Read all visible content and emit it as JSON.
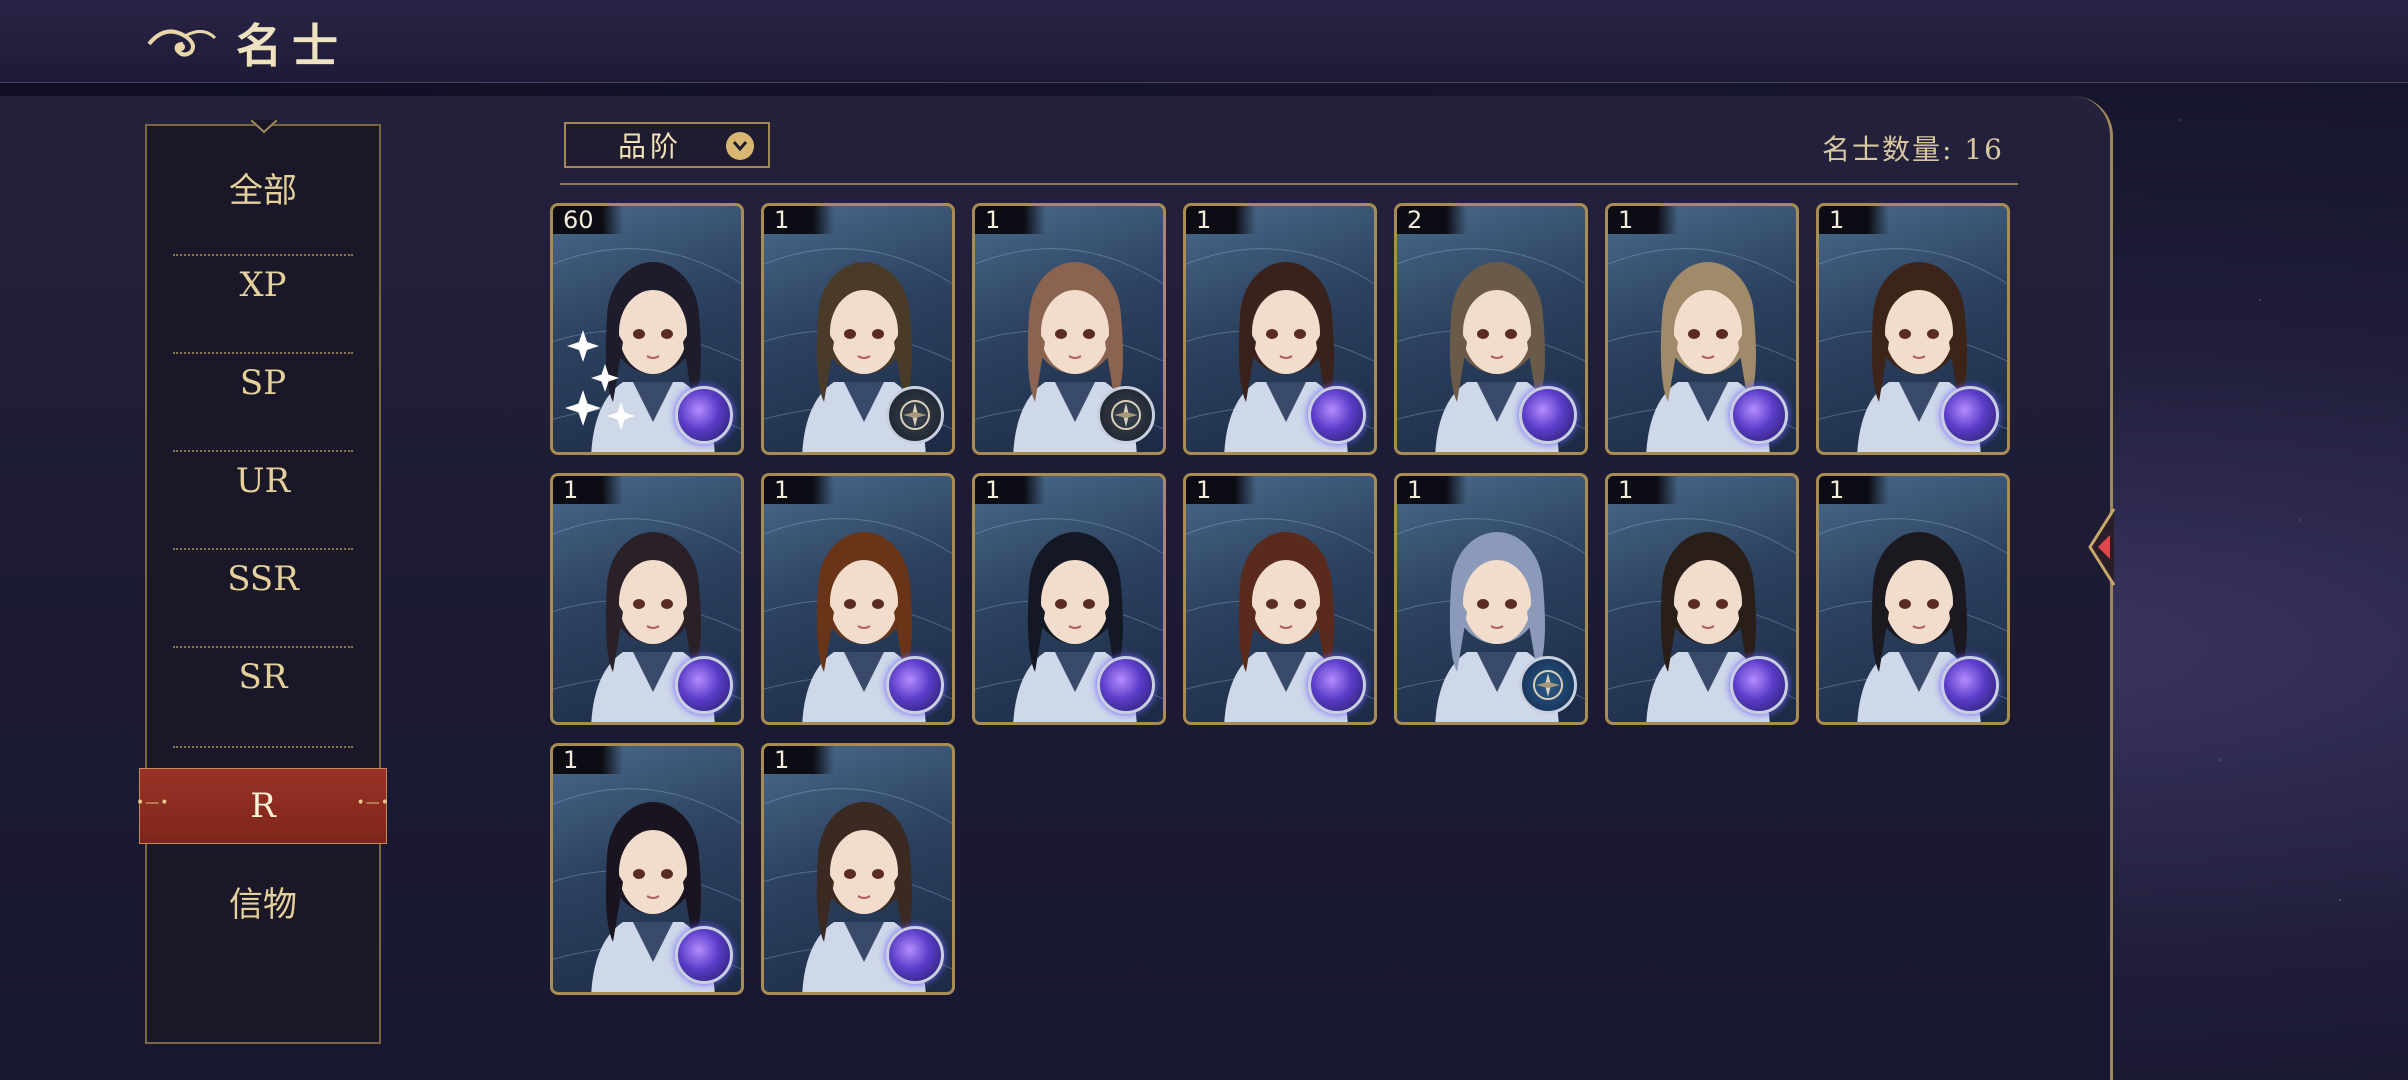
{
  "header": {
    "title": "名士"
  },
  "sidebar": {
    "items": [
      {
        "label": "全部",
        "active": false
      },
      {
        "label": "XP",
        "active": false
      },
      {
        "label": "SP",
        "active": false
      },
      {
        "label": "UR",
        "active": false
      },
      {
        "label": "SSR",
        "active": false
      },
      {
        "label": "SR",
        "active": false
      },
      {
        "label": "R",
        "active": true
      },
      {
        "label": "信物",
        "active": false
      }
    ]
  },
  "filter": {
    "label": "品阶",
    "icon": "chevron-down-icon"
  },
  "count": {
    "label": "名士数量:",
    "value": "16"
  },
  "colors": {
    "accent_gold": "#a88c52",
    "active_tab": "#8e2c20",
    "background": "#1b1a32"
  },
  "characters": [
    {
      "level": "60",
      "badge": "orb",
      "hair": "#1e1c2a",
      "sparkle": true
    },
    {
      "level": "1",
      "badge": "compass",
      "hair": "#4a3a28"
    },
    {
      "level": "1",
      "badge": "compass",
      "hair": "#8a6450"
    },
    {
      "level": "1",
      "badge": "orb",
      "hair": "#3a221c"
    },
    {
      "level": "2",
      "badge": "orb",
      "hair": "#6a5a4a"
    },
    {
      "level": "1",
      "badge": "orb",
      "hair": "#a08a6a"
    },
    {
      "level": "1",
      "badge": "orb",
      "hair": "#3c2418"
    },
    {
      "level": "1",
      "badge": "orb",
      "hair": "#2a2028"
    },
    {
      "level": "1",
      "badge": "orb",
      "hair": "#6a3418"
    },
    {
      "level": "1",
      "badge": "orb",
      "hair": "#141824"
    },
    {
      "level": "1",
      "badge": "orb",
      "hair": "#5a2a1c"
    },
    {
      "level": "1",
      "badge": "compass-blue",
      "hair": "#8a9ab8"
    },
    {
      "level": "1",
      "badge": "orb",
      "hair": "#2a1e18"
    },
    {
      "level": "1",
      "badge": "orb",
      "hair": "#1c1820"
    },
    {
      "level": "1",
      "badge": "orb",
      "hair": "#1a1420"
    },
    {
      "level": "1",
      "badge": "orb",
      "hair": "#3a2a22"
    }
  ]
}
